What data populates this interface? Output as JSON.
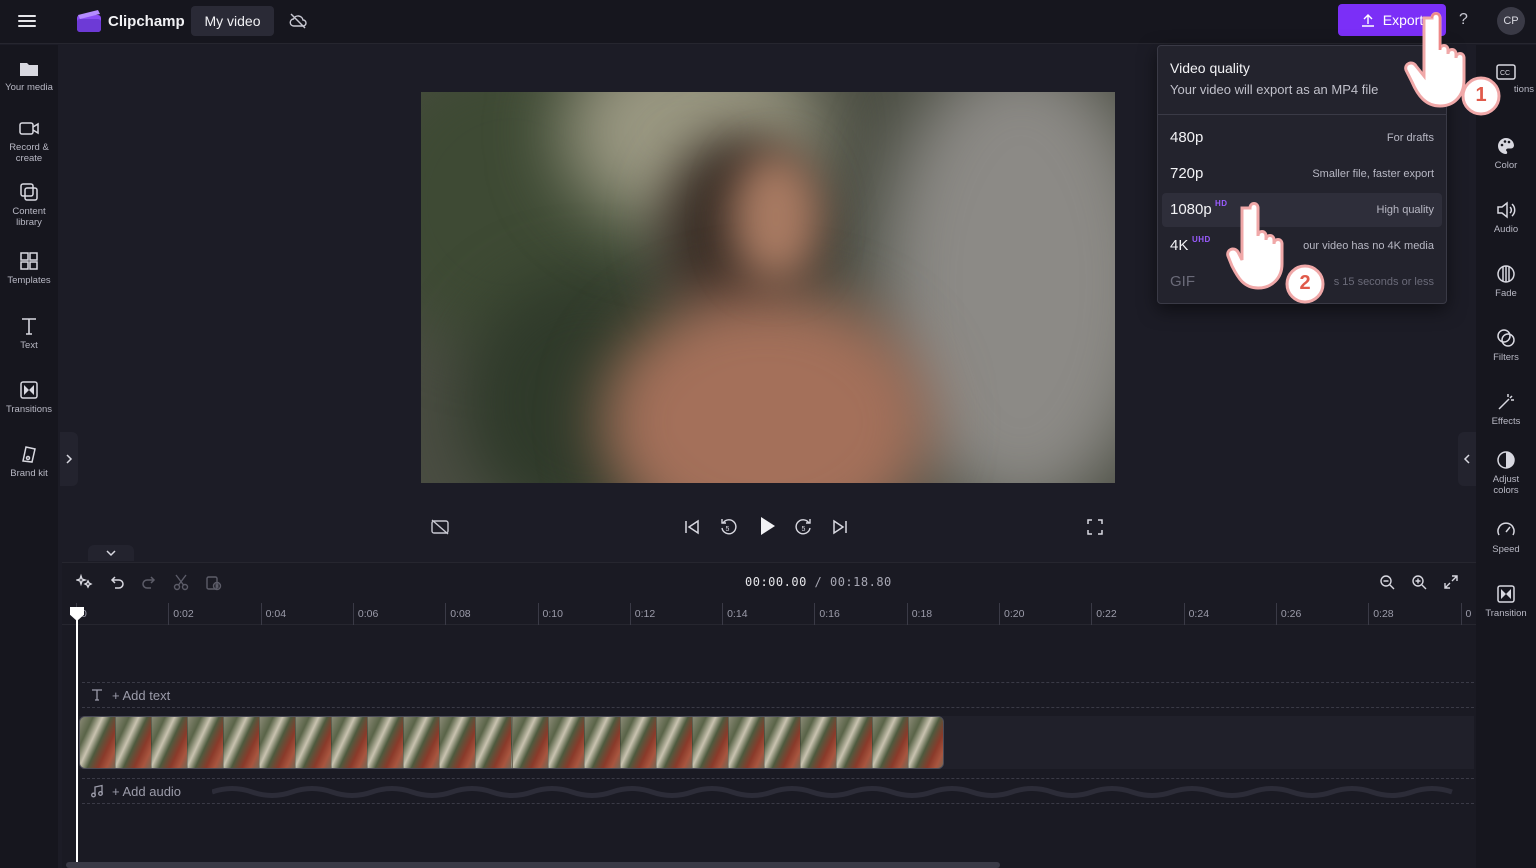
{
  "app": {
    "name": "Clipchamp",
    "project_title": "My video"
  },
  "header": {
    "export_label": "Export",
    "help": "?",
    "avatar": "CP"
  },
  "sidebar_left": [
    {
      "id": "your-media",
      "label": "Your media"
    },
    {
      "id": "record-create",
      "label": "Record &\ncreate"
    },
    {
      "id": "content-library",
      "label": "Content\nlibrary"
    },
    {
      "id": "templates",
      "label": "Templates"
    },
    {
      "id": "text",
      "label": "Text"
    },
    {
      "id": "transitions",
      "label": "Transitions"
    },
    {
      "id": "brand-kit",
      "label": "Brand kit"
    }
  ],
  "sidebar_right": [
    {
      "id": "captions",
      "label": "tions"
    },
    {
      "id": "color",
      "label": "Color"
    },
    {
      "id": "audio",
      "label": "Audio"
    },
    {
      "id": "fade",
      "label": "Fade"
    },
    {
      "id": "filters",
      "label": "Filters"
    },
    {
      "id": "effects",
      "label": "Effects"
    },
    {
      "id": "adjust-colors",
      "label": "Adjust\ncolors"
    },
    {
      "id": "speed",
      "label": "Speed"
    },
    {
      "id": "transition",
      "label": "Transition"
    }
  ],
  "timeline": {
    "current_time": "00:00.00",
    "separator": " / ",
    "total_time": "00:18.80",
    "ruler_ticks": [
      "0",
      "0:02",
      "0:04",
      "0:06",
      "0:08",
      "0:10",
      "0:12",
      "0:14",
      "0:16",
      "0:18",
      "0:20",
      "0:22",
      "0:24",
      "0:26",
      "0:28",
      "0"
    ],
    "add_text_label": "+ Add text",
    "add_audio_label": "+ Add audio"
  },
  "export_menu": {
    "title": "Video quality",
    "subtitle": "Your video will export as an MP4 file",
    "options": [
      {
        "resolution": "480p",
        "badge": "",
        "description": "For drafts",
        "state": "normal"
      },
      {
        "resolution": "720p",
        "badge": "",
        "description": "Smaller file, faster export",
        "state": "normal"
      },
      {
        "resolution": "1080p",
        "badge": "HD",
        "description": "High quality",
        "state": "active"
      },
      {
        "resolution": "4K",
        "badge": "UHD",
        "description": "our video has no 4K media",
        "state": "normal"
      },
      {
        "resolution": "GIF",
        "badge": "",
        "description": "s 15 seconds or less",
        "state": "disabled"
      }
    ]
  },
  "callouts": [
    {
      "number": "1"
    },
    {
      "number": "2"
    }
  ],
  "colors": {
    "accent": "#7b2ff7",
    "badge": "#9a5cff",
    "background": "#1c1c26",
    "panel": "#16161e"
  }
}
